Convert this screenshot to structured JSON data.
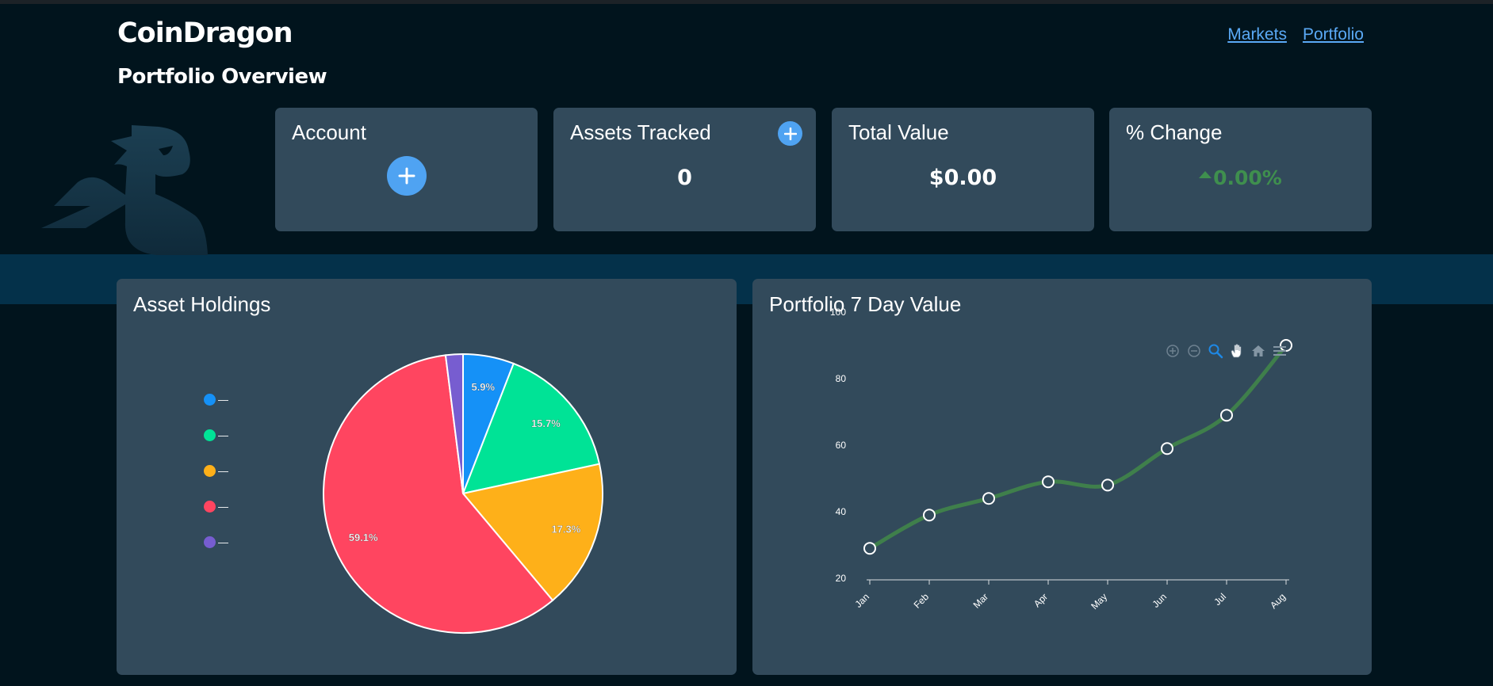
{
  "brand": "CoinDragon",
  "page_title": "Portfolio Overview",
  "nav": {
    "markets": "Markets",
    "portfolio": "Portfolio"
  },
  "cards": {
    "account": {
      "title": "Account"
    },
    "assets_tracked": {
      "title": "Assets Tracked",
      "value": "0"
    },
    "total_value": {
      "title": "Total Value",
      "value": "$0.00"
    },
    "percent_change": {
      "title": "% Change",
      "value": "0.00%"
    }
  },
  "colors": {
    "accent": "#4fa3f2",
    "positive": "#3f8f4e",
    "card_bg": "#324a5b",
    "page_bg": "#01141d"
  },
  "icons": {
    "toolbar": [
      "zoom-in-icon",
      "zoom-out-icon",
      "zoom-select-icon",
      "pan-icon",
      "home-icon",
      "menu-icon"
    ]
  },
  "asset_holdings": {
    "title": "Asset Holdings",
    "legend": [
      "—",
      "—",
      "—",
      "—",
      "—"
    ]
  },
  "portfolio_7day": {
    "title": "Portfolio 7 Day Value"
  },
  "chart_data": [
    {
      "type": "pie",
      "title": "Asset Holdings",
      "slices": [
        {
          "label": "—",
          "value": 5.9,
          "display": "5.9%",
          "color": "#1591f7"
        },
        {
          "label": "—",
          "value": 15.7,
          "display": "15.7%",
          "color": "#00e396"
        },
        {
          "label": "—",
          "value": 17.3,
          "display": "17.3%",
          "color": "#feb019"
        },
        {
          "label": "—",
          "value": 59.1,
          "display": "59.1%",
          "color": "#ff4560"
        },
        {
          "label": "—",
          "value": 2.0,
          "display": "",
          "color": "#775dd0"
        }
      ]
    },
    {
      "type": "line",
      "title": "Portfolio 7 Day Value",
      "categories": [
        "Jan",
        "Feb",
        "Mar",
        "Apr",
        "May",
        "Jun",
        "Jul",
        "Aug"
      ],
      "series": [
        {
          "values": [
            29,
            39,
            44,
            49,
            48,
            59,
            69,
            90
          ],
          "color": "#3f7f4b"
        }
      ],
      "yticks": [
        20,
        40,
        60,
        80,
        100
      ],
      "ylim": [
        20,
        100
      ],
      "grid": false
    }
  ]
}
